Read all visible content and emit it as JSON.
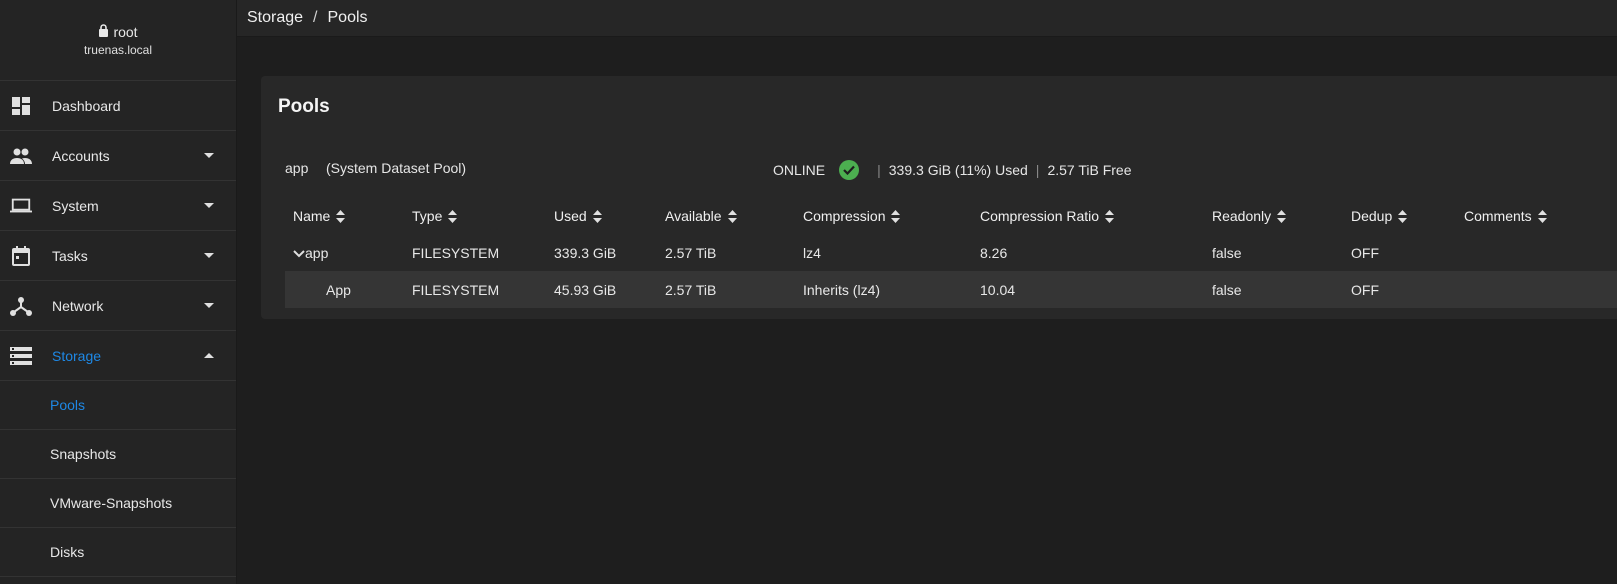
{
  "user": {
    "name": "root",
    "host": "truenas.local"
  },
  "breadcrumb": [
    "Storage",
    "Pools"
  ],
  "nav": [
    {
      "label": "Dashboard",
      "icon": "dashboard-icon",
      "caret": ""
    },
    {
      "label": "Accounts",
      "icon": "people-icon",
      "caret": "down"
    },
    {
      "label": "System",
      "icon": "laptop-icon",
      "caret": "down"
    },
    {
      "label": "Tasks",
      "icon": "calendar-icon",
      "caret": "down"
    },
    {
      "label": "Network",
      "icon": "network-icon",
      "caret": "down"
    },
    {
      "label": "Storage",
      "icon": "storage-icon",
      "caret": "up"
    }
  ],
  "storage_sub": [
    "Pools",
    "Snapshots",
    "VMware-Snapshots",
    "Disks"
  ],
  "card": {
    "title": "Pools",
    "pool_name": "app",
    "pool_desc": "(System Dataset Pool)",
    "status": "ONLINE",
    "used": "339.3 GiB (11%) Used",
    "free": "2.57 TiB Free"
  },
  "table": {
    "headers": [
      "Name",
      "Type",
      "Used",
      "Available",
      "Compression",
      "Compression Ratio",
      "Readonly",
      "Dedup",
      "Comments"
    ],
    "rows": [
      [
        "app",
        "FILESYSTEM",
        "339.3 GiB",
        "2.57 TiB",
        "lz4",
        "8.26",
        "false",
        "OFF",
        ""
      ],
      [
        "App",
        "FILESYSTEM",
        "45.93 GiB",
        "2.57 TiB",
        "Inherits (lz4)",
        "10.04",
        "false",
        "OFF",
        ""
      ]
    ]
  },
  "colors": {
    "accent": "#1e88e5",
    "online": "#4caf50",
    "background": "#1e1e1e",
    "card": "#282828"
  }
}
